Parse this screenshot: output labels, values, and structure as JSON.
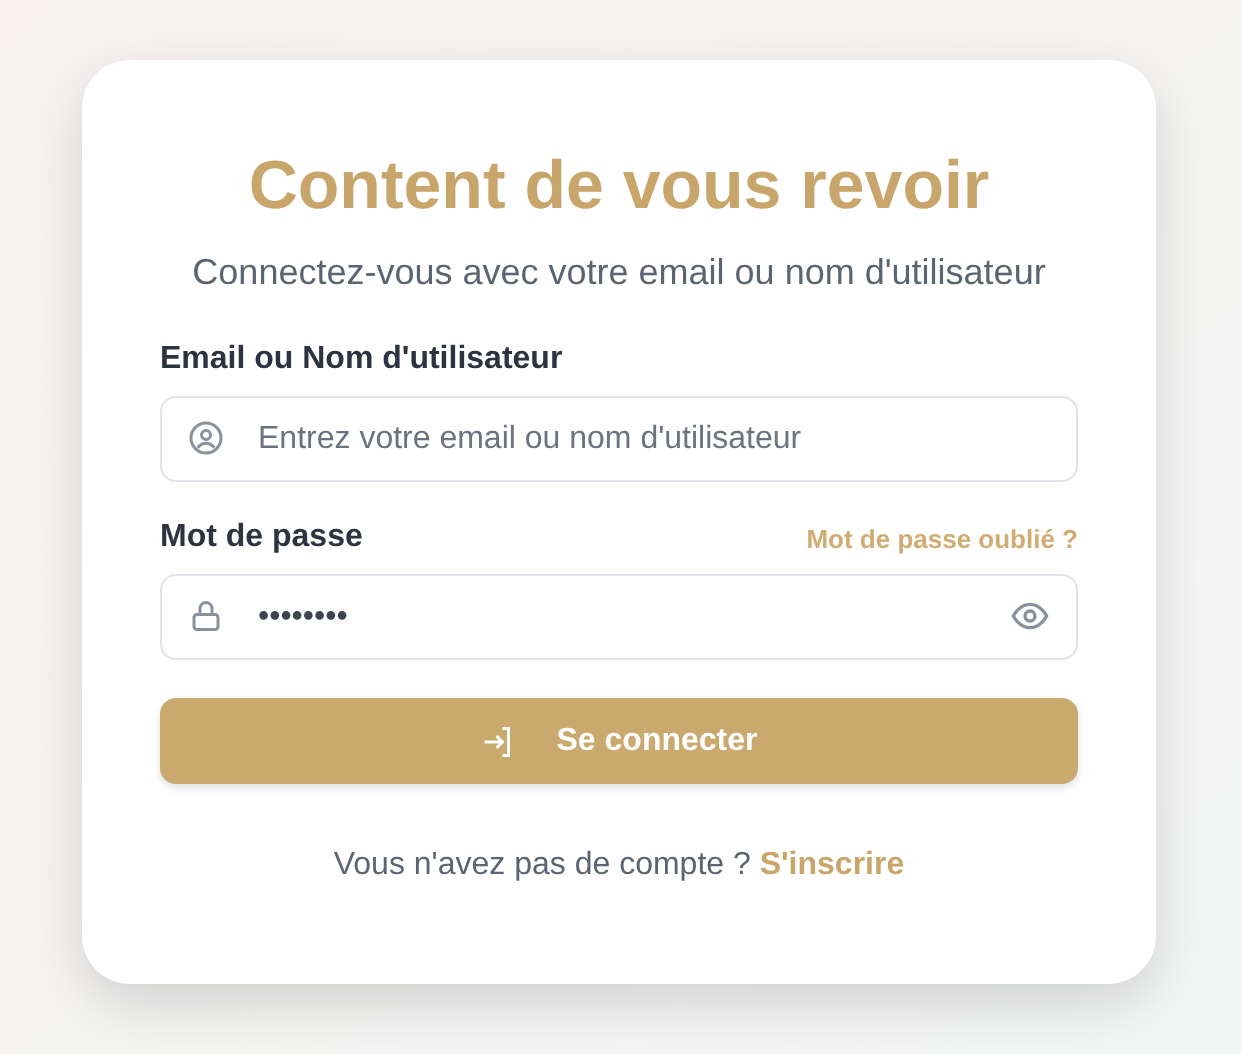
{
  "title": "Content de vous revoir",
  "subtitle": "Connectez-vous avec votre email ou nom d'utilisateur",
  "fields": [
    {
      "kind": "user",
      "label": "Email ou Nom d'utilisateur",
      "placeholder": "Entrez votre email ou nom d'utilisateur"
    },
    {
      "kind": "password",
      "label": "Mot de passe",
      "link": "Mot de passe oublié ?",
      "value": "••••••••"
    }
  ],
  "submit": "Se connecter",
  "footer": {
    "text": "Vous n'avez pas de compte ?",
    "link": "S'inscrire"
  }
}
